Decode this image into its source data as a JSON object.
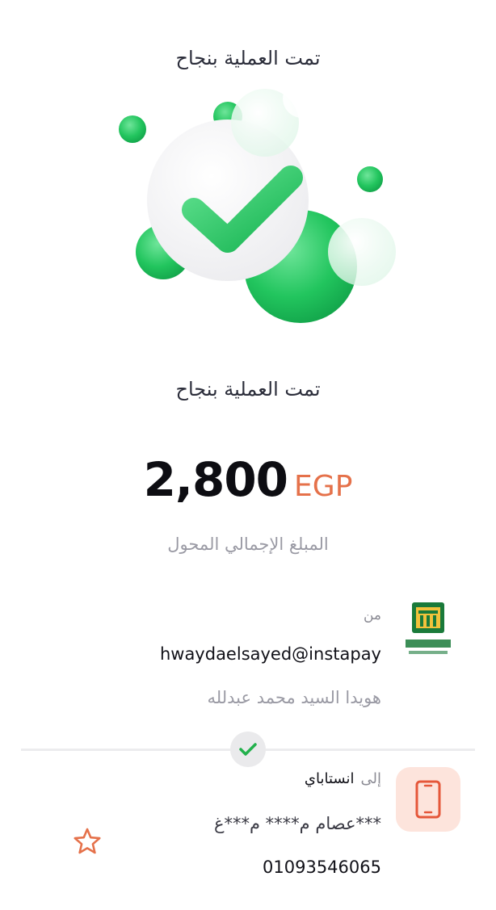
{
  "header": {
    "title": "تمت العملية بنجاح"
  },
  "status": {
    "title": "تمت العملية بنجاح"
  },
  "amount": {
    "value": "2,800",
    "currency": "EGP",
    "caption": "المبلغ الإجمالي المحول"
  },
  "from": {
    "label": "من",
    "handle": "hwaydaelsayed@instapay",
    "name": "هويدا السيد محمد عبدلله"
  },
  "to": {
    "label": "إلى",
    "service": "انستاباي",
    "name": "عصام م**** م***غ***",
    "phone": "01093546065"
  },
  "icons": {
    "hero": "success-check-icon",
    "bank": "bank-logo",
    "divider_check": "check-icon",
    "phone": "phone-icon",
    "favorite": "star-icon"
  },
  "colors": {
    "success": "#22c55e",
    "accent": "#e5714a",
    "phone_bg": "#fde4dc"
  }
}
